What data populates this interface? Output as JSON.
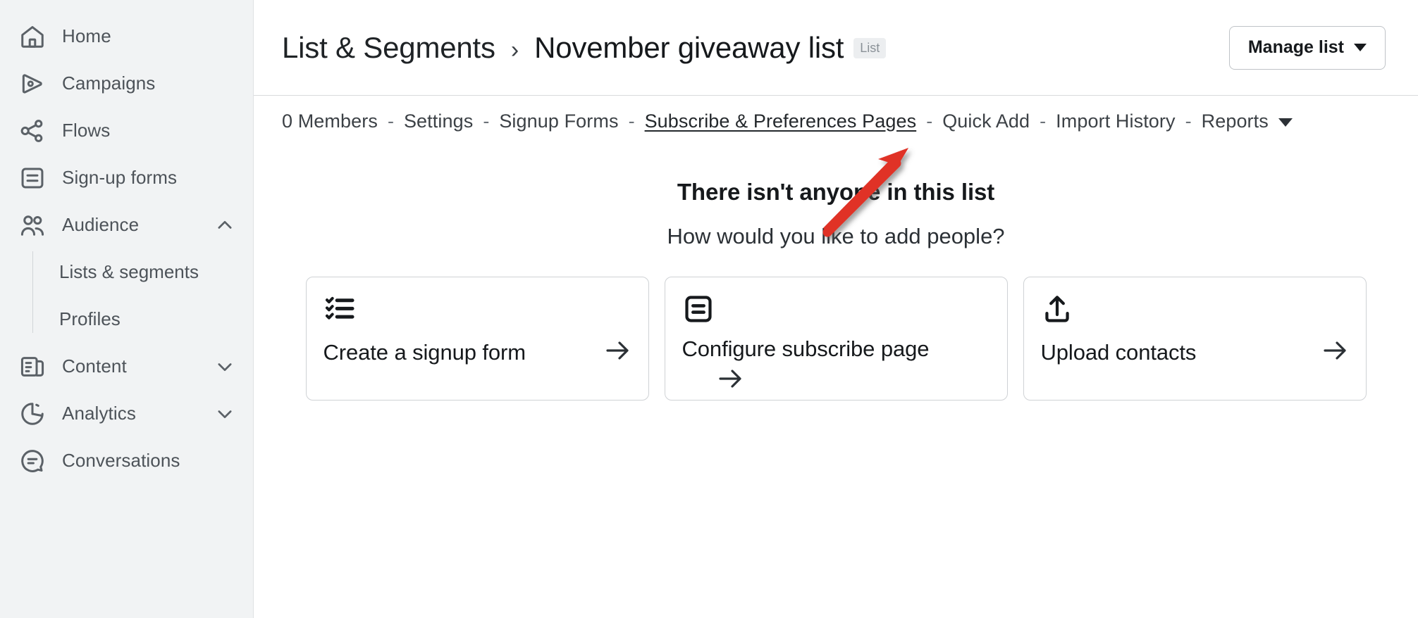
{
  "sidebar": {
    "items": [
      {
        "label": "Home",
        "icon": "home-icon",
        "expandable": false
      },
      {
        "label": "Campaigns",
        "icon": "send-icon",
        "expandable": false
      },
      {
        "label": "Flows",
        "icon": "flows-icon",
        "expandable": false
      },
      {
        "label": "Sign-up forms",
        "icon": "form-icon",
        "expandable": false
      },
      {
        "label": "Audience",
        "icon": "people-icon",
        "expandable": true,
        "state": "expanded",
        "chevron": "chevron-up-icon"
      },
      {
        "label": "Content",
        "icon": "content-icon",
        "expandable": true,
        "state": "collapsed",
        "chevron": "chevron-down-icon"
      },
      {
        "label": "Analytics",
        "icon": "pie-chart-icon",
        "expandable": true,
        "state": "collapsed",
        "chevron": "chevron-down-icon"
      },
      {
        "label": "Conversations",
        "icon": "chat-icon",
        "expandable": false
      }
    ],
    "audience_children": [
      {
        "label": "Lists & segments"
      },
      {
        "label": "Profiles"
      }
    ]
  },
  "header": {
    "breadcrumb_parent": "List & Segments",
    "breadcrumb_separator": "›",
    "breadcrumb_current": "November giveaway list",
    "badge": "List",
    "manage_button": "Manage list"
  },
  "subnav": {
    "separator": "-",
    "items": [
      {
        "label": "0 Members",
        "active": false
      },
      {
        "label": "Settings",
        "active": false
      },
      {
        "label": "Signup Forms",
        "active": false
      },
      {
        "label": "Subscribe & Preferences Pages",
        "active": true
      },
      {
        "label": "Quick Add",
        "active": false
      },
      {
        "label": "Import History",
        "active": false
      },
      {
        "label": "Reports",
        "active": false,
        "has_caret": true
      }
    ]
  },
  "empty_state": {
    "title": "There isn't anyone in this list",
    "subtitle": "How would you like to add people?",
    "cards": [
      {
        "label": "Create a signup form",
        "icon": "checklist-icon",
        "arrow": "arrow-right-icon",
        "layout": "wide"
      },
      {
        "label": "Configure subscribe page",
        "icon": "subscribe-page-icon",
        "arrow": "arrow-right-icon",
        "layout": "wrap"
      },
      {
        "label": "Upload contacts",
        "icon": "upload-icon",
        "arrow": "arrow-right-icon",
        "layout": "wide"
      }
    ]
  },
  "annotation": {
    "type": "red-arrow",
    "color": "#e03127",
    "points_to": "Subscribe & Preferences Pages"
  },
  "colors": {
    "sidebar_bg": "#f1f3f4",
    "page_bg": "#ffffff",
    "text_primary": "#16191c",
    "text_secondary": "#4d5359",
    "border": "#cfd2d5",
    "annotation_red": "#e03127",
    "badge_bg": "#eceef0"
  }
}
